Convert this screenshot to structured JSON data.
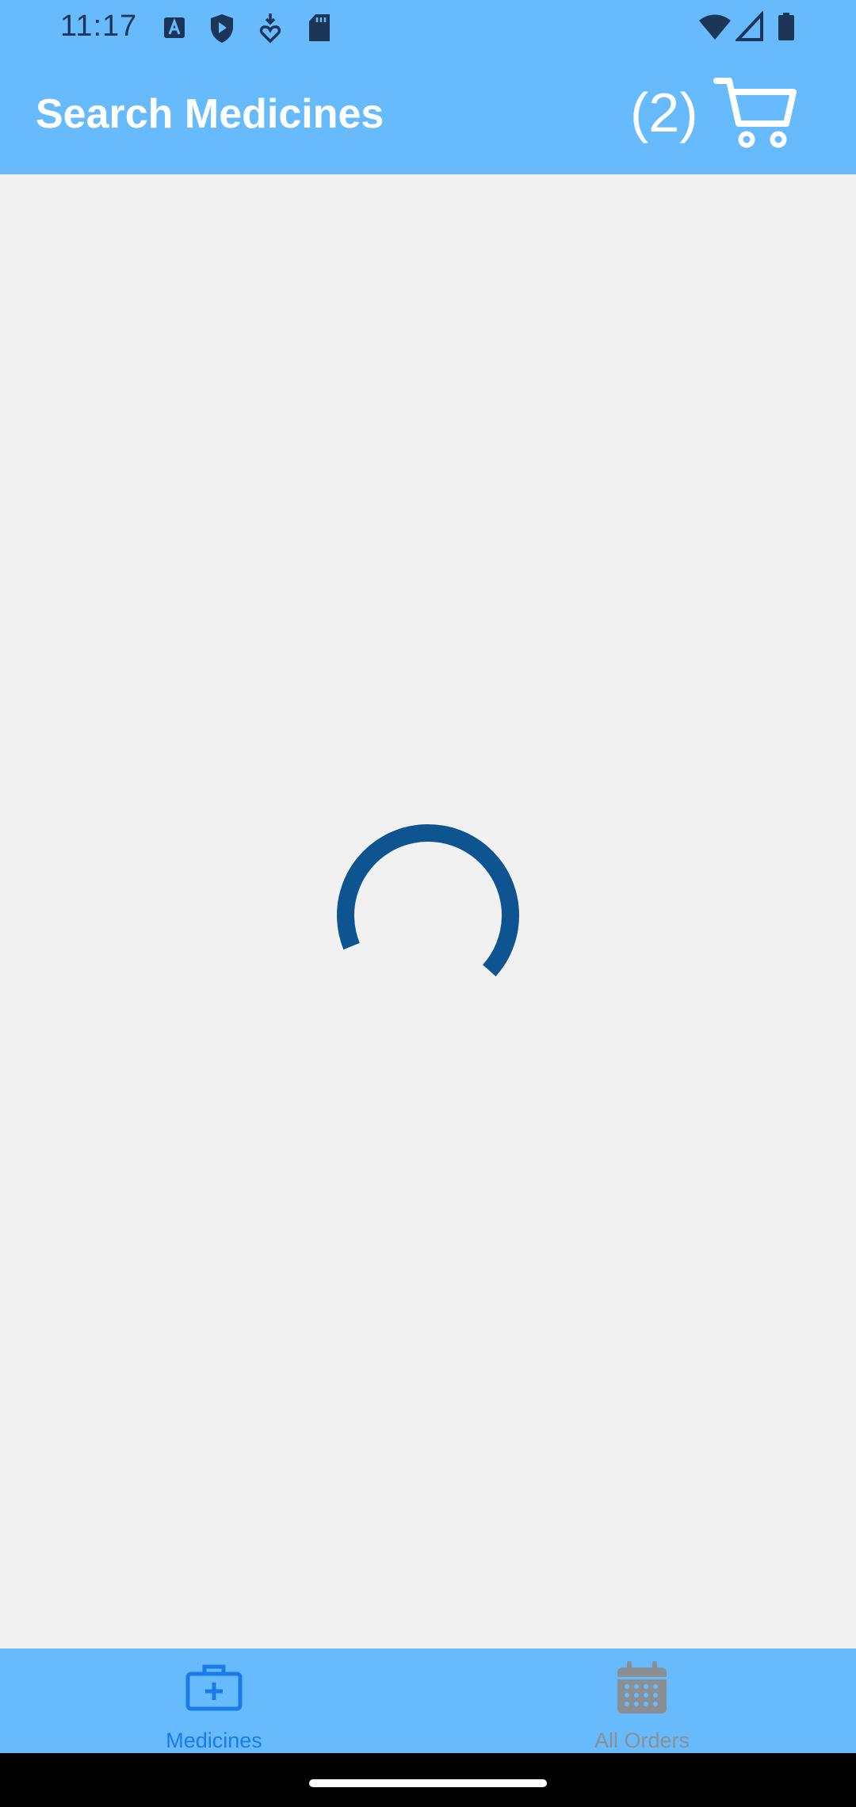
{
  "status_bar": {
    "time": "11:17",
    "icons": [
      "keyboard-a-icon",
      "shield-play-icon",
      "download-heart-icon",
      "sd-card-icon",
      "wifi-icon",
      "signal-icon",
      "battery-icon"
    ]
  },
  "app_bar": {
    "title": "Search Medicines",
    "cart_count": "(2)",
    "cart_icon": "shopping-cart-icon"
  },
  "content": {
    "state": "loading",
    "spinner_color": "#0d5490"
  },
  "bottom_nav": {
    "tabs": [
      {
        "label": "Medicines",
        "icon": "medical-kit-icon",
        "active": true
      },
      {
        "label": "All Orders",
        "icon": "calendar-icon",
        "active": false
      }
    ]
  },
  "colors": {
    "primary": "#67bbfd",
    "background": "#f1f1f1",
    "active_tab": "#1b7be8",
    "inactive_tab": "#8a8f94",
    "status_icons": "#1d3557"
  }
}
